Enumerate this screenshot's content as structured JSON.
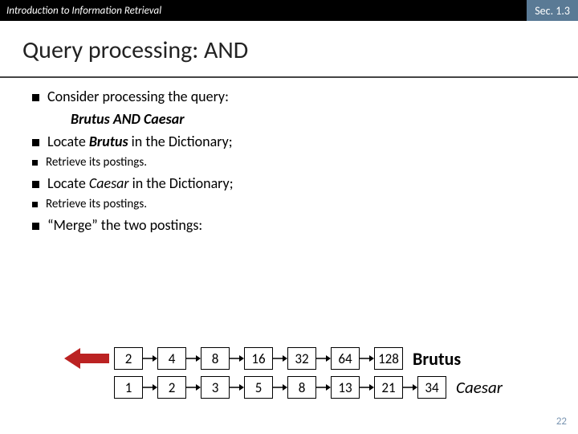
{
  "header": {
    "course": "Introduction to Information Retrieval",
    "section": "Sec. 1.3"
  },
  "title": "Query processing: AND",
  "bullets": {
    "b1": "Consider processing the query:",
    "query": "Brutus AND Caesar",
    "locate1_pre": "Locate ",
    "locate1_term": "Brutus",
    "locate1_post": " in the Dictionary;",
    "retrieve1": "Retrieve its postings.",
    "locate2_pre": "Locate ",
    "locate2_term": "Caesar",
    "locate2_post": " in the Dictionary;",
    "retrieve2": "Retrieve its postings.",
    "merge": "“Merge” the two postings:"
  },
  "postings": {
    "brutus": {
      "label": "Brutus",
      "values": [
        "2",
        "4",
        "8",
        "16",
        "32",
        "64",
        "128"
      ]
    },
    "caesar": {
      "label": "Caesar",
      "values": [
        "1",
        "2",
        "3",
        "5",
        "8",
        "13",
        "21",
        "34"
      ]
    }
  },
  "pagenum": "22"
}
